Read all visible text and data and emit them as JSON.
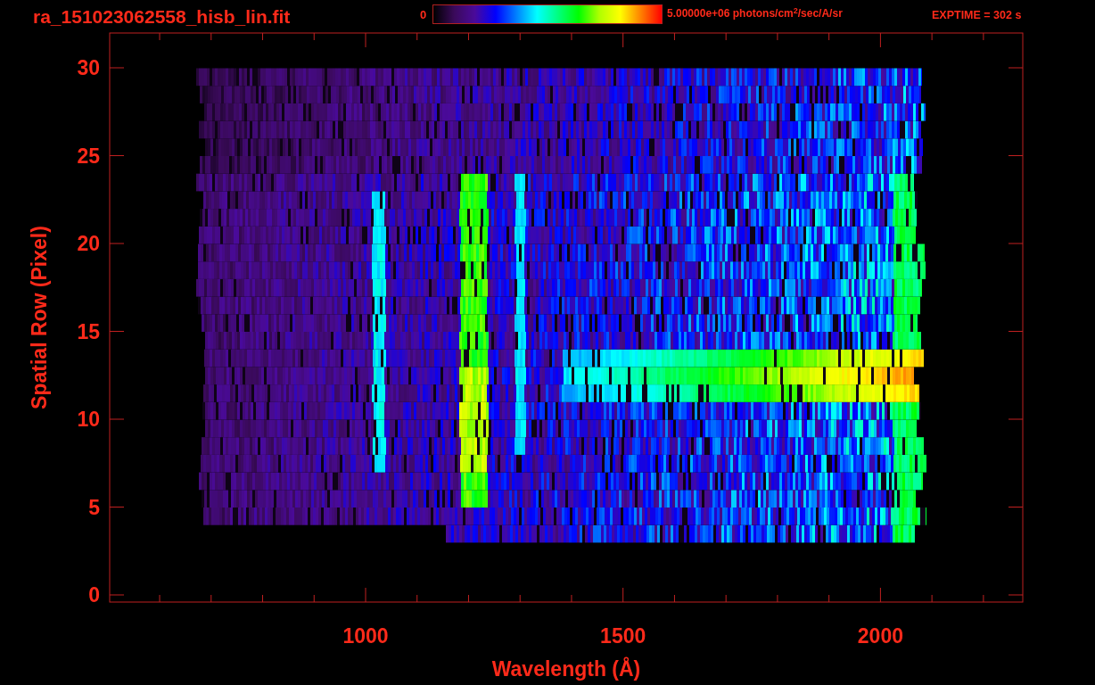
{
  "title": "ra_151023062558_hisb_lin.fit",
  "colorbar": {
    "min_label": "0",
    "max_label": "5.00000e+06 photons/cm$^{2}$/sec/A/sr"
  },
  "exposure": "EXPTIME = 302 s",
  "plot": {
    "xlabel": "Wavelength (Å)",
    "ylabel": "Spatial Row (Pixel)",
    "xtick_labels": [
      "1000",
      "1500",
      "2000"
    ],
    "ytick_labels": [
      "30",
      "25",
      "20",
      "15",
      "10",
      "5",
      "0"
    ]
  }
}
